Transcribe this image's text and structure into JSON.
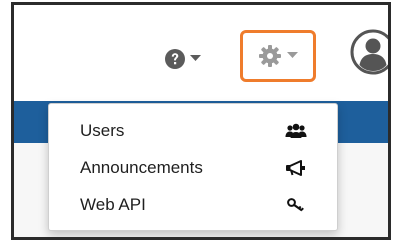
{
  "header": {
    "help_icon": "question-circle-icon",
    "settings_icon": "gear-icon",
    "user_icon": "user-avatar-icon",
    "accent_outline": "#ef7c2c",
    "nav_color": "#1e5f9c"
  },
  "menu": {
    "items": [
      {
        "label": "Users",
        "icon": "users-icon"
      },
      {
        "label": "Announcements",
        "icon": "megaphone-icon"
      },
      {
        "label": "Web API",
        "icon": "key-icon"
      }
    ]
  }
}
